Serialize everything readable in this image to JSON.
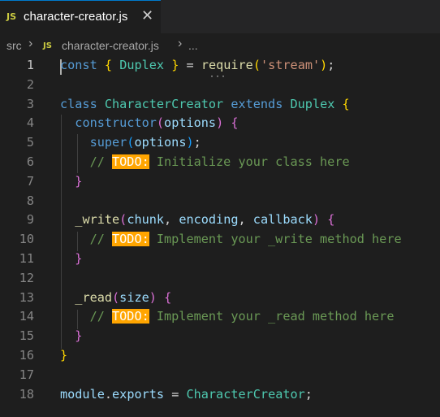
{
  "tab": {
    "badge": "JS",
    "name": "character-creator.js",
    "close": "✕"
  },
  "breadcrumb": {
    "folder": "src",
    "sep": "›",
    "badge": "JS",
    "file": "character-creator.js",
    "sep2": "›",
    "more": "..."
  },
  "editor": {
    "active_line": 1,
    "lines": [
      {
        "n": "1",
        "tokens": [
          [
            "k",
            "const"
          ],
          [
            "p",
            " "
          ],
          [
            "b1",
            "{"
          ],
          [
            "p",
            " "
          ],
          [
            "c",
            "Duplex"
          ],
          [
            "p",
            " "
          ],
          [
            "b1",
            "}"
          ],
          [
            "p",
            " = "
          ],
          [
            "f",
            "require"
          ],
          [
            "b1",
            "("
          ],
          [
            "s",
            "'stream'"
          ],
          [
            "b1",
            ")"
          ],
          [
            "p",
            ";"
          ]
        ]
      },
      {
        "n": "2",
        "tokens": []
      },
      {
        "n": "3",
        "tokens": [
          [
            "k",
            "class"
          ],
          [
            "p",
            " "
          ],
          [
            "c",
            "CharacterCreator"
          ],
          [
            "p",
            " "
          ],
          [
            "k",
            "extends"
          ],
          [
            "p",
            " "
          ],
          [
            "c",
            "Duplex"
          ],
          [
            "p",
            " "
          ],
          [
            "b1",
            "{"
          ]
        ]
      },
      {
        "n": "4",
        "tokens": [
          [
            "p",
            "  "
          ],
          [
            "k",
            "constructor"
          ],
          [
            "b2",
            "("
          ],
          [
            "v",
            "options"
          ],
          [
            "b2",
            ")"
          ],
          [
            "p",
            " "
          ],
          [
            "b2",
            "{"
          ]
        ]
      },
      {
        "n": "5",
        "tokens": [
          [
            "p",
            "    "
          ],
          [
            "k",
            "super"
          ],
          [
            "b3",
            "("
          ],
          [
            "v",
            "options"
          ],
          [
            "b3",
            ")"
          ],
          [
            "p",
            ";"
          ]
        ]
      },
      {
        "n": "6",
        "tokens": [
          [
            "p",
            "    "
          ],
          [
            "cm",
            "// "
          ],
          [
            "todo",
            "TODO:"
          ],
          [
            "cm",
            " Initialize your class here"
          ]
        ]
      },
      {
        "n": "7",
        "tokens": [
          [
            "p",
            "  "
          ],
          [
            "b2",
            "}"
          ]
        ]
      },
      {
        "n": "8",
        "tokens": []
      },
      {
        "n": "9",
        "tokens": [
          [
            "p",
            "  "
          ],
          [
            "f",
            "_write"
          ],
          [
            "b2",
            "("
          ],
          [
            "v",
            "chunk"
          ],
          [
            "p",
            ", "
          ],
          [
            "v",
            "encoding"
          ],
          [
            "p",
            ", "
          ],
          [
            "v",
            "callback"
          ],
          [
            "b2",
            ")"
          ],
          [
            "p",
            " "
          ],
          [
            "b2",
            "{"
          ]
        ]
      },
      {
        "n": "10",
        "tokens": [
          [
            "p",
            "    "
          ],
          [
            "cm",
            "// "
          ],
          [
            "todo",
            "TODO:"
          ],
          [
            "cm",
            " Implement your _write method here"
          ]
        ]
      },
      {
        "n": "11",
        "tokens": [
          [
            "p",
            "  "
          ],
          [
            "b2",
            "}"
          ]
        ]
      },
      {
        "n": "12",
        "tokens": []
      },
      {
        "n": "13",
        "tokens": [
          [
            "p",
            "  "
          ],
          [
            "f",
            "_read"
          ],
          [
            "b2",
            "("
          ],
          [
            "v",
            "size"
          ],
          [
            "b2",
            ")"
          ],
          [
            "p",
            " "
          ],
          [
            "b2",
            "{"
          ]
        ]
      },
      {
        "n": "14",
        "tokens": [
          [
            "p",
            "    "
          ],
          [
            "cm",
            "// "
          ],
          [
            "todo",
            "TODO:"
          ],
          [
            "cm",
            " Implement your _read method here"
          ]
        ]
      },
      {
        "n": "15",
        "tokens": [
          [
            "p",
            "  "
          ],
          [
            "b2",
            "}"
          ]
        ]
      },
      {
        "n": "16",
        "tokens": [
          [
            "b1",
            "}"
          ]
        ]
      },
      {
        "n": "17",
        "tokens": []
      },
      {
        "n": "18",
        "tokens": [
          [
            "v",
            "module"
          ],
          [
            "p",
            "."
          ],
          [
            "v",
            "exports"
          ],
          [
            "p",
            " = "
          ],
          [
            "c",
            "CharacterCreator"
          ],
          [
            "p",
            ";"
          ]
        ]
      }
    ]
  },
  "colors": {
    "accent": "#007acc",
    "todo_bg": "#ffa500",
    "editor_bg": "#1e1e1e"
  }
}
